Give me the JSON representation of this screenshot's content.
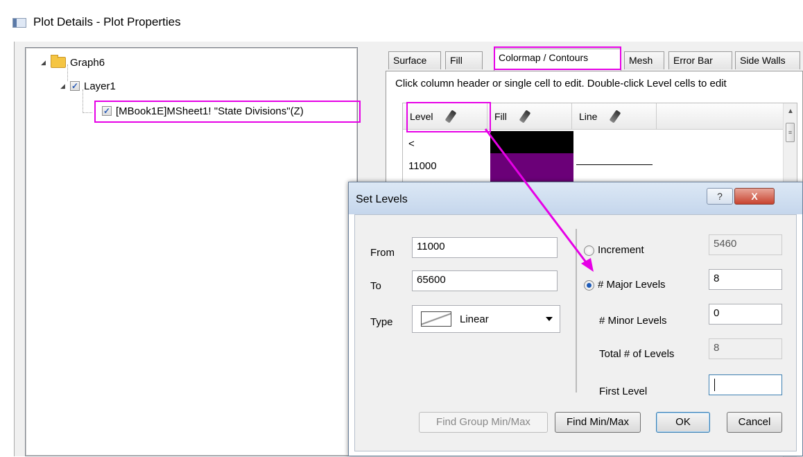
{
  "window": {
    "title": "Plot Details - Plot Properties"
  },
  "tree": {
    "graph": "Graph6",
    "layer": "Layer1",
    "plot": "[MBook1E]MSheet1! \"State Divisions\"(Z)"
  },
  "tabs": [
    "Surface",
    "Fill",
    "Colormap / Contours",
    "Mesh",
    "Error Bar",
    "Side Walls"
  ],
  "colormap": {
    "hint": "Click column header or single cell to edit. Double-click Level cells to edit",
    "columns": [
      "Level",
      "Fill",
      "Line"
    ],
    "rows": [
      "<",
      "11000"
    ]
  },
  "set_levels": {
    "title": "Set Levels",
    "help_label": "?",
    "close_label": "X",
    "from_label": "From",
    "from_value": "11000",
    "to_label": "To",
    "to_value": "65600",
    "type_label": "Type",
    "type_value": "Linear",
    "increment_label": "Increment",
    "increment_value": "5460",
    "major_levels_label": "# Major Levels",
    "major_levels_value": "8",
    "minor_levels_label": "# Minor Levels",
    "minor_levels_value": "0",
    "total_levels_label": "Total # of Levels",
    "total_levels_value": "8",
    "first_level_label": "First Level",
    "first_level_value": "",
    "find_group_label": "Find Group Min/Max",
    "find_minmax_label": "Find Min/Max",
    "ok_label": "OK",
    "cancel_label": "Cancel"
  },
  "colors": {
    "highlight": "#e600e6",
    "swatch_black": "#000000",
    "swatch_purple": "#6b0078"
  }
}
